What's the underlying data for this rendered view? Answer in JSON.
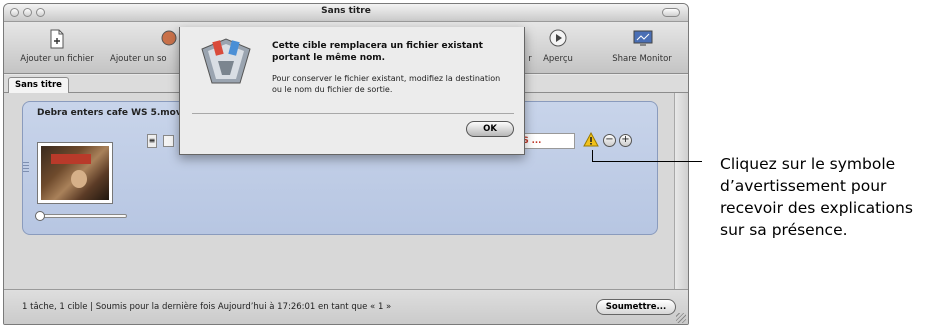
{
  "window": {
    "title": "Sans titre"
  },
  "toolbar": {
    "add_file": "Ajouter un fichier",
    "add_surround": "Ajouter un so",
    "preview_partial": "r",
    "preview": "Aperçu",
    "share_monitor": "Share Monitor"
  },
  "tabs": [
    {
      "label": "Sans titre"
    }
  ],
  "job": {
    "title": "Debra enters cafe WS 5.mov",
    "destination": "cafe WS ...",
    "handle_glyph": "≡"
  },
  "buttons": {
    "minus": "−",
    "plus": "+"
  },
  "status": {
    "text": "1 tâche, 1 cible  |  Soumis pour la dernière fois Aujourd’hui à 17:26:01 en tant que « 1 »",
    "submit": "Soumettre..."
  },
  "dialog": {
    "title": "Cette cible remplacera un fichier existant portant le même nom.",
    "message": "Pour conserver le fichier existant, modifiez la destination ou le nom du fichier de sortie.",
    "ok": "OK"
  },
  "callout": {
    "text": "Cliquez sur le symbole d’avertissement pour recevoir des explications sur sa présence."
  },
  "icons": {
    "add_file": "document-add-icon",
    "preview": "play-circle-icon",
    "share_monitor": "monitor-icon",
    "warning": "warning-triangle-icon",
    "compressor": "compressor-app-icon"
  },
  "colors": {
    "job_panel": "#b7c6e2",
    "destination_text": "#c0392b",
    "warning": "#f2c21b"
  }
}
